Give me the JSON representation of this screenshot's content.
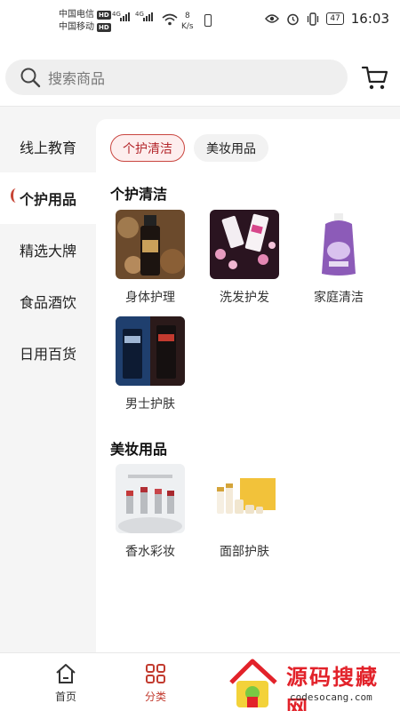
{
  "status_bar": {
    "carrier_1": "中国电信",
    "carrier_2": "中国移动",
    "hd_badge": "HD",
    "network_1": "4G",
    "network_2": "4G",
    "speed_value": "8",
    "speed_unit": "K/s",
    "battery": "47",
    "time": "16:03"
  },
  "search": {
    "placeholder": "搜索商品"
  },
  "sidebar": {
    "items": [
      {
        "label": "线上教育"
      },
      {
        "label": "个护用品"
      },
      {
        "label": "精选大牌"
      },
      {
        "label": "食品酒饮"
      },
      {
        "label": "日用百货"
      }
    ],
    "selected_index": 1
  },
  "content": {
    "chips": [
      {
        "label": "个护清洁"
      },
      {
        "label": "美妆用品"
      }
    ],
    "selected_chip_index": 0,
    "sections": [
      {
        "title": "个护清洁",
        "items": [
          {
            "label": "身体护理"
          },
          {
            "label": "洗发护发"
          },
          {
            "label": "家庭清洁"
          },
          {
            "label": "男士护肤"
          }
        ]
      },
      {
        "title": "美妆用品",
        "items": [
          {
            "label": "香水彩妆"
          },
          {
            "label": "面部护肤"
          }
        ]
      }
    ]
  },
  "tabbar": {
    "tabs": [
      {
        "label": "首页"
      },
      {
        "label": "分类"
      }
    ],
    "active_index": 1
  },
  "watermark": {
    "title": "源码搜藏网",
    "subtitle": "codesocang.com"
  },
  "colors": {
    "accent": "#c23b2f",
    "chip_active_bg": "#fdeeee",
    "page_bg": "#f5f5f5"
  }
}
